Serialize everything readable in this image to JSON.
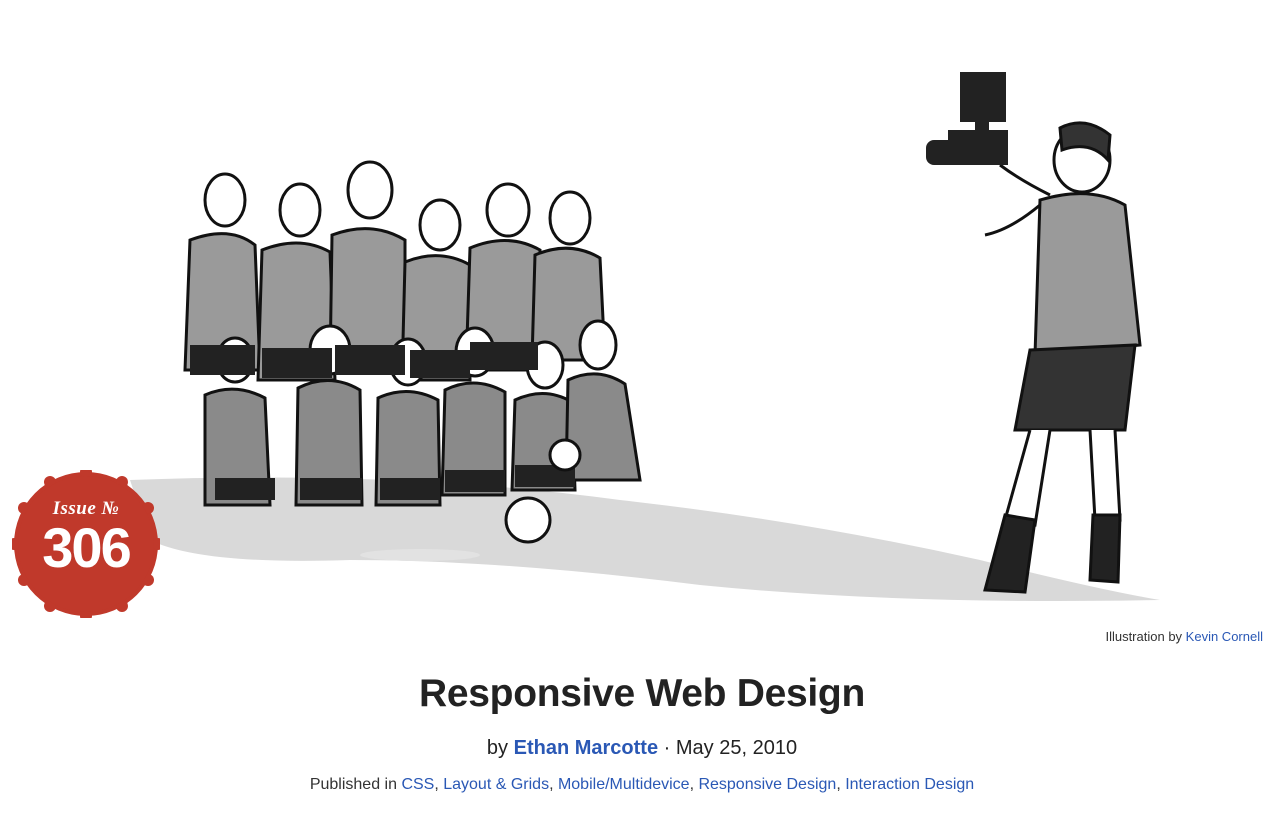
{
  "badge": {
    "label": "Issue №",
    "number": "306"
  },
  "illustration": {
    "credit_prefix": "Illustration by",
    "credit_name": "Kevin Cornell"
  },
  "article": {
    "title": "Responsive Web Design",
    "by": "by",
    "author": "Ethan Marcotte",
    "separator": "·",
    "date": "May 25, 2010",
    "published_in": "Published in",
    "categories": [
      "CSS",
      "Layout & Grids",
      "Mobile/Multidevice",
      "Responsive Design",
      "Interaction Design"
    ]
  },
  "colors": {
    "badge": "#c0392b",
    "link": "#2a58b5",
    "text": "#222222"
  }
}
